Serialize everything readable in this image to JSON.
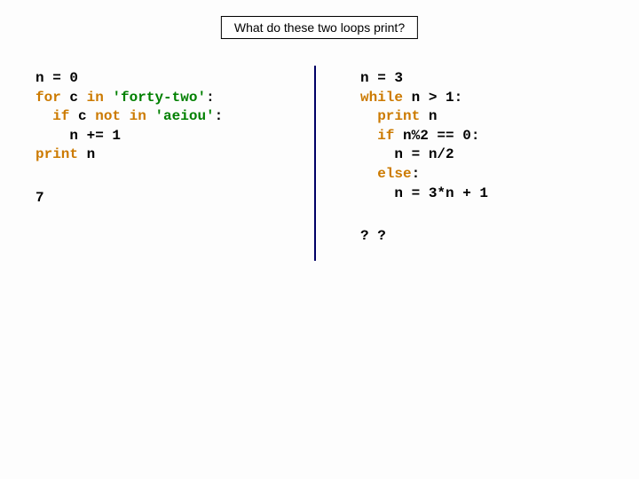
{
  "title": "What do these two loops print?",
  "left": {
    "l1a": "n = 0",
    "l2a": "for",
    "l2b": " c ",
    "l2c": "in",
    "l2d": " ",
    "l2e": "'forty-two'",
    "l2f": ":",
    "l3a": "  ",
    "l3b": "if",
    "l3c": " c ",
    "l3d": "not in",
    "l3e": " ",
    "l3f": "'aeiou'",
    "l3g": ":",
    "l4a": "    n += 1",
    "l5a": "print",
    "l5b": " n",
    "answer": "7"
  },
  "right": {
    "l1a": "n = 3",
    "l2a": "while",
    "l2b": " n > 1:",
    "l3a": "  ",
    "l3b": "print",
    "l3c": " n",
    "l4a": "  ",
    "l4b": "if",
    "l4c": " n%2 == 0:",
    "l5a": "    n = n/2",
    "l6a": "  ",
    "l6b": "else",
    "l6c": ":",
    "l7a": "    n = 3*n + 1",
    "answer": "? ?"
  }
}
